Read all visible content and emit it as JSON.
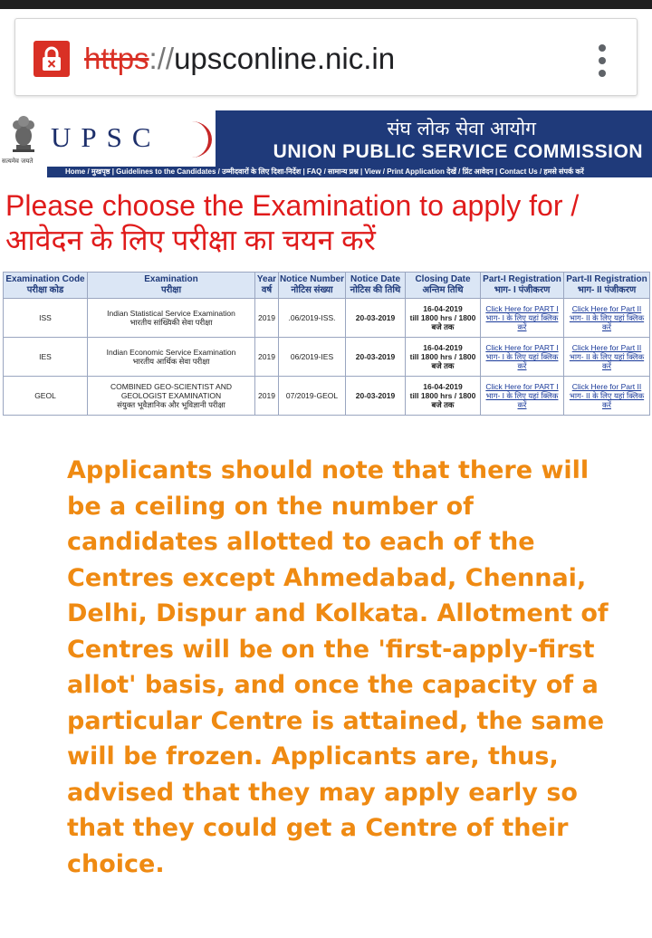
{
  "browser": {
    "url_protocol": "https",
    "url_separator": "://",
    "url_host": "upsconline.nic.in"
  },
  "header": {
    "logo_letters": "UPSC",
    "emblem_caption": "सत्यमेव जयते",
    "hindi_name": "संघ लोक सेवा आयोग",
    "english_name": "UNION PUBLIC SERVICE COMMISSION",
    "nav": "Home / मुखपृष्ठ | Guidelines to the Candidates / उम्मीदवारों के लिए दिशा-निर्देश | FAQ / सामान्य प्रश्न | View / Print Application देखें / प्रिंट आवेदन | Contact Us / हमसे संपर्क करें"
  },
  "page": {
    "choose_en": "Please choose the Examination to apply for /",
    "choose_hi": "आवेदन के लिए परीक्षा का चयन करें"
  },
  "table": {
    "headers": [
      {
        "en": "Examination Code",
        "hi": "परीक्षा कोड"
      },
      {
        "en": "Examination",
        "hi": "परीक्षा"
      },
      {
        "en": "Year",
        "hi": "वर्ष"
      },
      {
        "en": "Notice Number",
        "hi": "नोटिस संख्या"
      },
      {
        "en": "Notice Date",
        "hi": "नोटिस की तिथि"
      },
      {
        "en": "Closing Date",
        "hi": "अन्तिम तिथि"
      },
      {
        "en": "Part-I Registration",
        "hi": "भाग- I पंजीकरण"
      },
      {
        "en": "Part-II Registration",
        "hi": "भाग- II पंजीकरण"
      }
    ],
    "rows": [
      {
        "code": "ISS",
        "exam_en": "Indian Statistical Service Examination",
        "exam_hi": "भारतीय सांख्यिकी सेवा परीक्षा",
        "year": "2019",
        "notice_no": ".06/2019-ISS.",
        "notice_date": "20-03-2019",
        "closing_date": "16-04-2019",
        "closing_time": "till 1800 hrs / 1800",
        "closing_hi": "बजे तक",
        "part1_en": "Click Here for PART I",
        "part1_hi": "भाग- I के लिए यहां क्लिक करें",
        "part2_en": "Click Here for Part II",
        "part2_hi": "भाग- II के लिए यहां क्लिक करें"
      },
      {
        "code": "IES",
        "exam_en": "Indian Economic Service Examination",
        "exam_hi": "भारतीय आर्थिक सेवा परीक्षा",
        "year": "2019",
        "notice_no": "06/2019-IES",
        "notice_date": "20-03-2019",
        "closing_date": "16-04-2019",
        "closing_time": "till 1800 hrs / 1800",
        "closing_hi": "बजे तक",
        "part1_en": "Click Here for PART I",
        "part1_hi": "भाग- I के लिए यहां क्लिक करें",
        "part2_en": "Click Here for Part II",
        "part2_hi": "भाग- II के लिए यहां क्लिक करें"
      },
      {
        "code": "GEOL",
        "exam_en": "COMBINED GEO-SCIENTIST AND GEOLOGIST EXAMINATION",
        "exam_hi": "संयुक्त भूवैज्ञानिक और भूविज्ञानी परीक्षा",
        "year": "2019",
        "notice_no": "07/2019-GEOL",
        "notice_date": "20-03-2019",
        "closing_date": "16-04-2019",
        "closing_time": "till 1800 hrs / 1800",
        "closing_hi": "बजे तक",
        "part1_en": "Click Here for PART I",
        "part1_hi": "भाग- I के लिए यहां क्लिक करें",
        "part2_en": "Click Here for Part II",
        "part2_hi": "भाग- II के लिए यहां क्लिक करें"
      }
    ]
  },
  "notice": "Applicants should note that there will be a ceiling on the number of candidates allotted to each of the Centres except Ahmedabad, Chennai, Delhi, Dispur and Kolkata. Allotment of Centres will be on the 'first-apply-first allot' basis, and once the capacity of a particular Centre is attained, the same will be frozen. Applicants are, thus, advised that they may apply early so that they could get a Centre of their choice.",
  "colors": {
    "alert_red": "#e01b1b",
    "notice_orange": "#ef8a12",
    "header_blue": "#1f3a7a",
    "date_green": "#1f8a1f"
  }
}
